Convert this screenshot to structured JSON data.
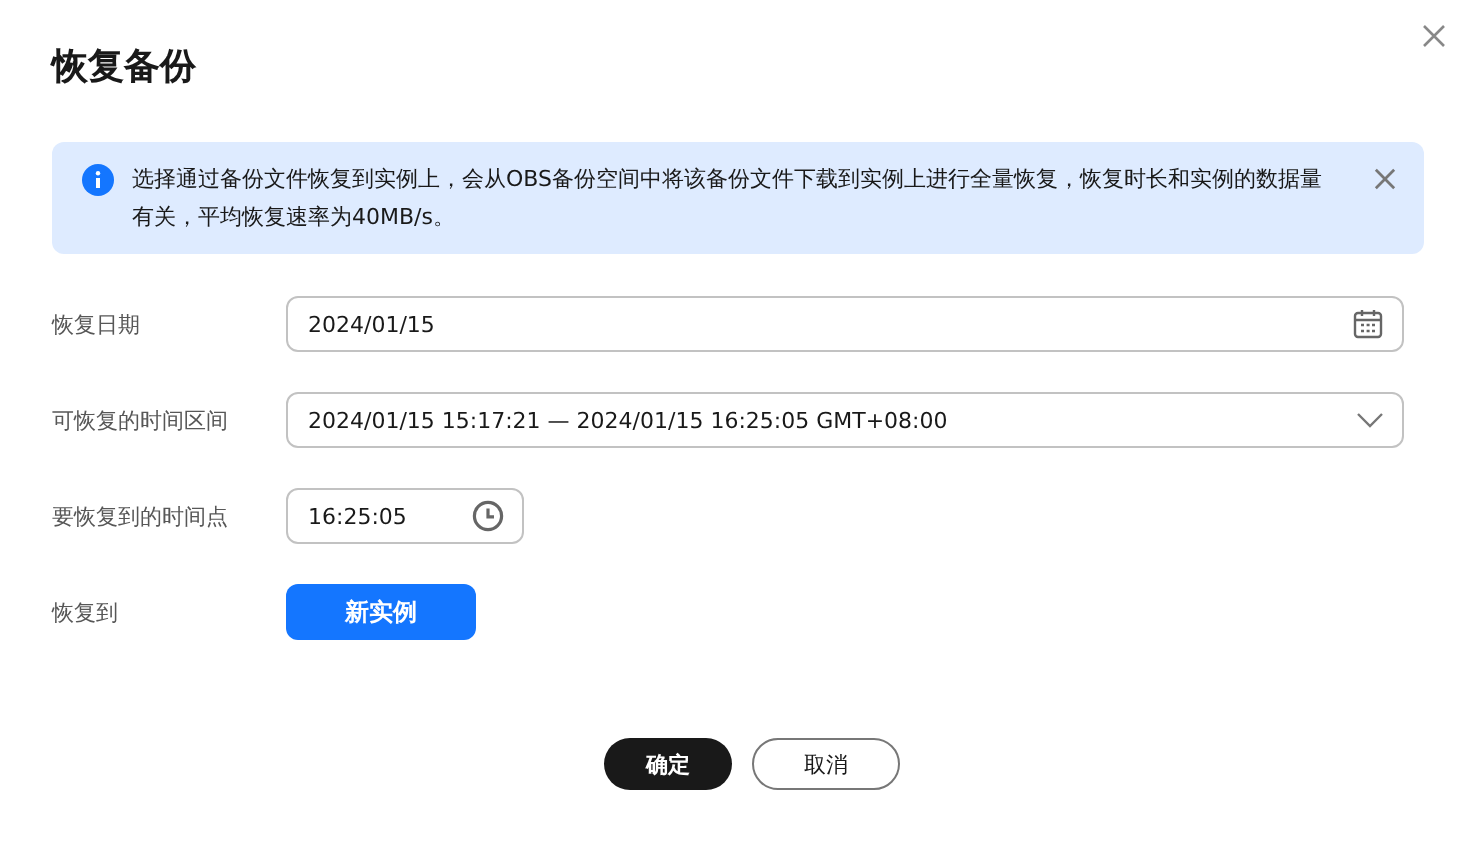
{
  "dialog": {
    "title": "恢复备份"
  },
  "alert": {
    "text": "选择通过备份文件恢复到实例上，会从OBS备份空间中将该备份文件下载到实例上进行全量恢复，恢复时长和实例的数据量有关，平均恢复速率为40MB/s。"
  },
  "form": [
    {
      "kind": "date",
      "label": "恢复日期",
      "value": "2024/01/15"
    },
    {
      "kind": "select",
      "label": "可恢复的时间区间",
      "value": "2024/01/15 15:17:21 — 2024/01/15 16:25:05 GMT+08:00"
    },
    {
      "kind": "time",
      "label": "要恢复到的时间点",
      "value": "16:25:05"
    },
    {
      "kind": "button",
      "label": "恢复到",
      "value": "新实例"
    }
  ],
  "buttons": [
    {
      "label": "确定",
      "kind": "primary"
    },
    {
      "label": "取消",
      "kind": "secondary"
    }
  ]
}
